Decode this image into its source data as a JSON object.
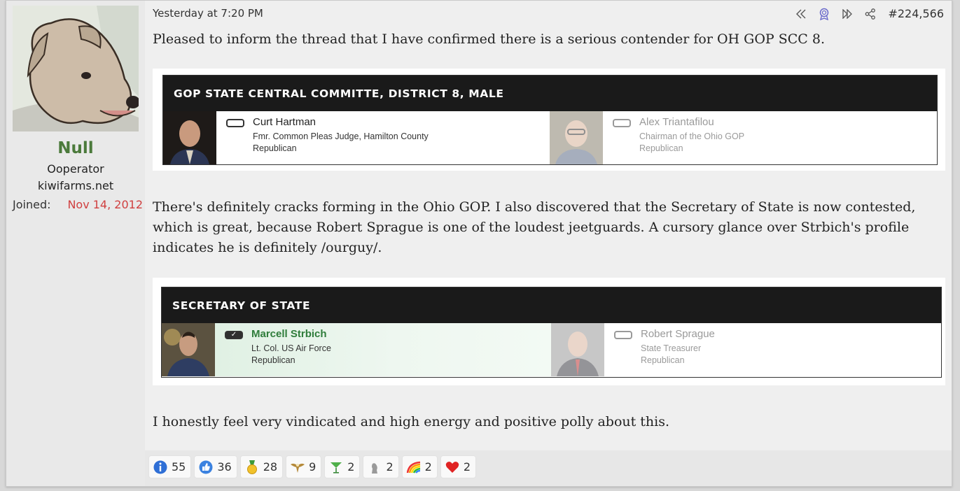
{
  "user": {
    "name": "Null",
    "title": "Ooperator",
    "site": "kiwifarms.net",
    "joined_label": "Joined:",
    "joined_date": "Nov 14, 2012"
  },
  "post": {
    "date": "Yesterday at 7:20 PM",
    "number": "#224,566",
    "paragraph1": "Pleased to inform the thread that I have confirmed there is a serious contender for OH GOP SCC 8.",
    "paragraph2": "There's definitely cracks forming in the Ohio GOP. I also discovered that the Secretary of State is now contested, which is great, because Robert Sprague is one of the loudest jeetguards. A cursory glance over Strbich's profile indicates he is definitely /ourguy/.",
    "paragraph3": "I honestly feel very vindicated and high energy and positive polly about this."
  },
  "ballot1": {
    "heading": "GOP STATE CENTRAL COMMITTE, DISTRICT 8, MALE",
    "candidates": [
      {
        "name": "Curt Hartman",
        "line1": "Fmr. Common Pleas Judge, Hamilton County",
        "line2": "Republican"
      },
      {
        "name": "Alex Triantafilou",
        "line1": "Chairman of the Ohio GOP",
        "line2": "Republican"
      }
    ]
  },
  "ballot2": {
    "heading": "SECRETARY OF STATE",
    "candidates": [
      {
        "name": "Marcell Strbich",
        "line1": "Lt. Col. US Air Force",
        "line2": "Republican",
        "check": "✓"
      },
      {
        "name": "Robert Sprague",
        "line1": "State Treasurer",
        "line2": "Republican"
      }
    ]
  },
  "reactions": [
    {
      "icon": "informative-icon",
      "count": "55"
    },
    {
      "icon": "like-icon",
      "count": "36"
    },
    {
      "icon": "winner-medal-icon",
      "count": "28"
    },
    {
      "icon": "eagle-emblem-icon",
      "count": "9"
    },
    {
      "icon": "cocktail-icon",
      "count": "2"
    },
    {
      "icon": "chess-piece-icon",
      "count": "2"
    },
    {
      "icon": "rainbow-icon",
      "count": "2"
    },
    {
      "icon": "heart-icon",
      "count": "2"
    }
  ],
  "colors": {
    "username": "#4b7a3b",
    "joined_date": "#d04040",
    "winner": "#2f7d3b"
  }
}
